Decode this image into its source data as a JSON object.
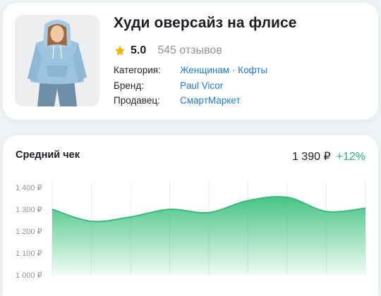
{
  "product": {
    "title": "Худи оверсайз на флисе",
    "rating": "5.0",
    "reviews": "545 отзывов",
    "category_label": "Категория:",
    "category_part1": "Женщинам",
    "category_sep": " · ",
    "category_part2": "Кофты",
    "brand_label": "Бренд:",
    "brand_value": "Paul Vicor",
    "seller_label": "Продавец:",
    "seller_value": "СмартМаркет"
  },
  "colors": {
    "star": "#f5b400",
    "link": "#1f7ae0",
    "positive": "#22b573",
    "chart_line": "#3cb97a",
    "chart_fill_top": "#45c483"
  },
  "chart_data": {
    "type": "area",
    "title": "Средний чек",
    "current_value": "1 390 ₽",
    "change": "+12%",
    "ylim": [
      1000,
      1400
    ],
    "y_ticks": [
      "1 400 ₽",
      "1 300 ₽",
      "1 200 ₽",
      "1 100 ₽",
      "1 000 ₽"
    ],
    "y_tick_values": [
      1400,
      1300,
      1200,
      1100,
      1000
    ],
    "grid": "vertical",
    "x": [
      0,
      1,
      2,
      3,
      4,
      5,
      6,
      7,
      8
    ],
    "values": [
      1300,
      1245,
      1265,
      1300,
      1285,
      1340,
      1355,
      1290,
      1305
    ]
  }
}
